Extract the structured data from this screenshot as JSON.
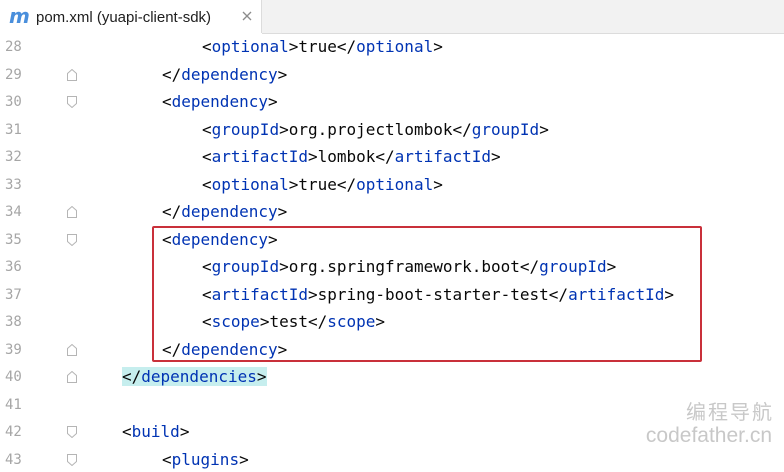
{
  "tab": {
    "icon_letter": "m",
    "title": "pom.xml (yuapi-client-sdk)"
  },
  "colors": {
    "tag": "#0033b3",
    "text": "#080808",
    "line_number": "#a6a6a6",
    "highlight_box": "#c9303a",
    "tag_match_highlight": "#c6eeee",
    "tab_icon": "#4a8fdc"
  },
  "lines": [
    {
      "number": "28",
      "fold": "",
      "highlight": false,
      "segments": [
        {
          "t": "<",
          "c": "p"
        },
        {
          "t": "optional",
          "c": "tag"
        },
        {
          "t": ">",
          "c": "p"
        },
        {
          "t": "true",
          "c": "text"
        },
        {
          "t": "</",
          "c": "p"
        },
        {
          "t": "optional",
          "c": "tag"
        },
        {
          "t": ">",
          "c": "p"
        }
      ]
    },
    {
      "number": "29",
      "fold": "end",
      "highlight": false,
      "segments": [
        {
          "t": "</",
          "c": "p"
        },
        {
          "t": "dependency",
          "c": "tag"
        },
        {
          "t": ">",
          "c": "p"
        }
      ]
    },
    {
      "number": "30",
      "fold": "start",
      "highlight": false,
      "segments": [
        {
          "t": "<",
          "c": "p"
        },
        {
          "t": "dependency",
          "c": "tag"
        },
        {
          "t": ">",
          "c": "p"
        }
      ]
    },
    {
      "number": "31",
      "fold": "",
      "highlight": false,
      "segments": [
        {
          "t": "<",
          "c": "p"
        },
        {
          "t": "groupId",
          "c": "tag"
        },
        {
          "t": ">",
          "c": "p"
        },
        {
          "t": "org.projectlombok",
          "c": "text"
        },
        {
          "t": "</",
          "c": "p"
        },
        {
          "t": "groupId",
          "c": "tag"
        },
        {
          "t": ">",
          "c": "p"
        }
      ]
    },
    {
      "number": "32",
      "fold": "",
      "highlight": false,
      "segments": [
        {
          "t": "<",
          "c": "p"
        },
        {
          "t": "artifactId",
          "c": "tag"
        },
        {
          "t": ">",
          "c": "p"
        },
        {
          "t": "lombok",
          "c": "text"
        },
        {
          "t": "</",
          "c": "p"
        },
        {
          "t": "artifactId",
          "c": "tag"
        },
        {
          "t": ">",
          "c": "p"
        }
      ]
    },
    {
      "number": "33",
      "fold": "",
      "highlight": false,
      "segments": [
        {
          "t": "<",
          "c": "p"
        },
        {
          "t": "optional",
          "c": "tag"
        },
        {
          "t": ">",
          "c": "p"
        },
        {
          "t": "true",
          "c": "text"
        },
        {
          "t": "</",
          "c": "p"
        },
        {
          "t": "optional",
          "c": "tag"
        },
        {
          "t": ">",
          "c": "p"
        }
      ]
    },
    {
      "number": "34",
      "fold": "end",
      "highlight": false,
      "segments": [
        {
          "t": "</",
          "c": "p"
        },
        {
          "t": "dependency",
          "c": "tag"
        },
        {
          "t": ">",
          "c": "p"
        }
      ]
    },
    {
      "number": "35",
      "fold": "start",
      "highlight": false,
      "segments": [
        {
          "t": "<",
          "c": "p"
        },
        {
          "t": "dependency",
          "c": "tag"
        },
        {
          "t": ">",
          "c": "p"
        }
      ]
    },
    {
      "number": "36",
      "fold": "",
      "highlight": false,
      "segments": [
        {
          "t": "<",
          "c": "p"
        },
        {
          "t": "groupId",
          "c": "tag"
        },
        {
          "t": ">",
          "c": "p"
        },
        {
          "t": "org.springframework.boot",
          "c": "text"
        },
        {
          "t": "</",
          "c": "p"
        },
        {
          "t": "groupId",
          "c": "tag"
        },
        {
          "t": ">",
          "c": "p"
        }
      ]
    },
    {
      "number": "37",
      "fold": "",
      "highlight": false,
      "segments": [
        {
          "t": "<",
          "c": "p"
        },
        {
          "t": "artifactId",
          "c": "tag"
        },
        {
          "t": ">",
          "c": "p"
        },
        {
          "t": "spring-boot-starter-test",
          "c": "text"
        },
        {
          "t": "</",
          "c": "p"
        },
        {
          "t": "artifactId",
          "c": "tag"
        },
        {
          "t": ">",
          "c": "p"
        }
      ]
    },
    {
      "number": "38",
      "fold": "",
      "highlight": false,
      "segments": [
        {
          "t": "<",
          "c": "p"
        },
        {
          "t": "scope",
          "c": "tag"
        },
        {
          "t": ">",
          "c": "p"
        },
        {
          "t": "test",
          "c": "text"
        },
        {
          "t": "</",
          "c": "p"
        },
        {
          "t": "scope",
          "c": "tag"
        },
        {
          "t": ">",
          "c": "p"
        }
      ]
    },
    {
      "number": "39",
      "fold": "end",
      "highlight": false,
      "segments": [
        {
          "t": "</",
          "c": "p"
        },
        {
          "t": "dependency",
          "c": "tag"
        },
        {
          "t": ">",
          "c": "p"
        }
      ]
    },
    {
      "number": "40",
      "fold": "end",
      "highlight": true,
      "segments": [
        {
          "t": "</",
          "c": "p"
        },
        {
          "t": "dependencies",
          "c": "tag"
        },
        {
          "t": ">",
          "c": "p"
        }
      ]
    },
    {
      "number": "41",
      "fold": "",
      "highlight": false,
      "segments": []
    },
    {
      "number": "42",
      "fold": "start",
      "highlight": false,
      "segments": [
        {
          "t": "<",
          "c": "p"
        },
        {
          "t": "build",
          "c": "tag"
        },
        {
          "t": ">",
          "c": "p"
        }
      ]
    },
    {
      "number": "43",
      "fold": "start",
      "highlight": false,
      "segments": [
        {
          "t": "<",
          "c": "p"
        },
        {
          "t": "plugins",
          "c": "tag"
        },
        {
          "t": ">",
          "c": "p"
        }
      ]
    }
  ],
  "watermark": {
    "line1": "编程导航",
    "line2": "codefather.cn"
  }
}
